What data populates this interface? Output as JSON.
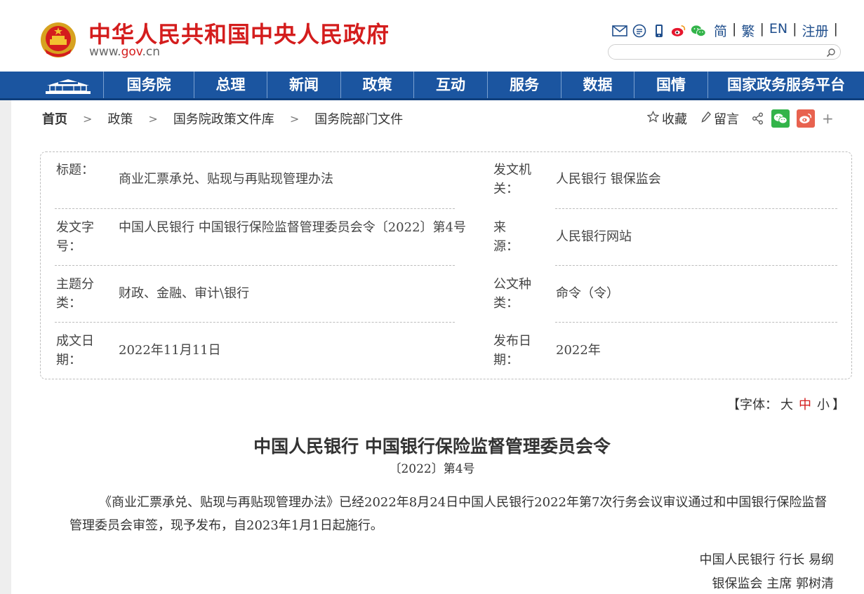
{
  "header": {
    "site_title": "中华人民共和国中央人民政府",
    "site_url_prefix": "www.",
    "site_url_brand": "gov",
    "site_url_suffix": ".cn",
    "lang_links": [
      "简",
      "繁",
      "EN",
      "注册"
    ],
    "search_placeholder": "",
    "icons": [
      "mail-icon",
      "message-icon",
      "mobile-icon",
      "weibo-icon",
      "wechat-icon"
    ]
  },
  "nav": {
    "items": [
      "国务院",
      "总理",
      "新闻",
      "政策",
      "互动",
      "服务",
      "数据",
      "国情",
      "国家政务服务平台"
    ]
  },
  "breadcrumb": {
    "items": [
      "首页",
      "政策",
      "国务院政策文件库",
      "国务院部门文件"
    ]
  },
  "tools": {
    "favorite": "收藏",
    "comment": "留言",
    "plus": "+"
  },
  "info": {
    "rows": [
      {
        "label1": "标题：",
        "value1": "商业汇票承兑、贴现与再贴现管理办法",
        "label2": "发文机关：",
        "value2": "人民银行 银保监会"
      },
      {
        "label1": "发文字号：",
        "value1": "中国人民银行 中国银行保险监督管理委员会令〔2022〕第4号",
        "label2": "来源：",
        "value2": "人民银行网站"
      },
      {
        "label1": "主题分类：",
        "value1": "财政、金融、审计\\银行",
        "label2": "公文种类：",
        "value2": "命令（令）"
      },
      {
        "label1": "成文日期：",
        "value1": "2022年11月11日",
        "label2": "发布日期：",
        "value2": "2022年"
      }
    ]
  },
  "font_size": {
    "open": "【字体：",
    "options": [
      "大",
      "中",
      "小"
    ],
    "active": "中",
    "close": "】"
  },
  "document": {
    "title": "中国人民银行 中国银行保险监督管理委员会令",
    "number": "〔2022〕第4号",
    "paragraph": "《商业汇票承兑、贴现与再贴现管理办法》已经2022年8月24日中国人民银行2022年第7次行务会议审议通过和中国银行保险监督管理委员会审签，现予发布，自2023年1月1日起施行。",
    "signatures": [
      "中国人民银行 行长 易纲",
      "银保监会 主席 郭树清"
    ]
  },
  "colors": {
    "brand_red": "#d41d1d",
    "nav_blue": "#1b55a0",
    "link_blue": "#1f4e8c",
    "wechat_green": "#33b44a",
    "weibo_red": "#e8624f"
  }
}
